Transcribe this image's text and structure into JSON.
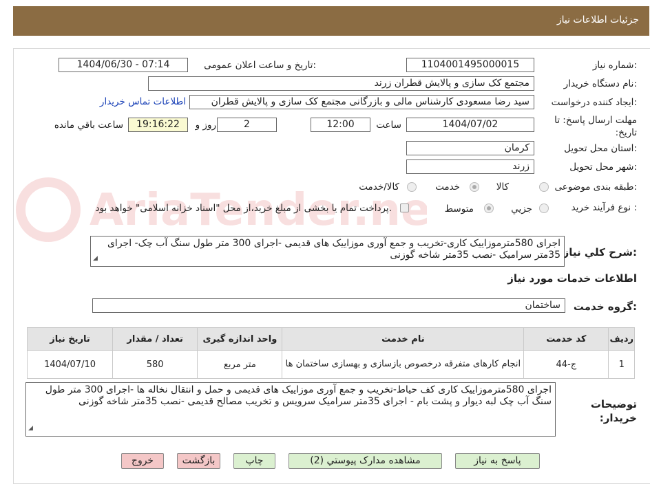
{
  "header": {
    "title": "جزئیات اطلاعات نیاز"
  },
  "form": {
    "need_number_label": "شماره نیاز:",
    "need_number": "1104001495000015",
    "announce_label": "تاریخ و ساعت اعلان عمومی:",
    "announce_value": "1404/06/30 - 07:14",
    "buyer_org_label": "نام دستگاه خریدار:",
    "buyer_org": "مجتمع کک سازی و پالایش قطران زرند",
    "requester_label": "ایجاد کننده درخواست:",
    "requester": "سید رضا مسعودی کارشناس مالی و بازرگانی مجتمع کک سازی و پالایش قطران",
    "contact_link": "اطلاعات تماس خریدار",
    "deadline_label": "مهلت ارسال پاسخ: تا تاریخ:",
    "deadline_date": "1404/07/02",
    "time_label": "ساعت",
    "deadline_time": "12:00",
    "days_value": "2",
    "days_label": "روز و",
    "remaining_time": "19:16:22",
    "remaining_label": "ساعت باقي مانده",
    "province_label": "استان محل تحویل:",
    "province": "کرمان",
    "city_label": "شهر محل تحویل:",
    "city": "زرند",
    "category_label": "طبقه بندی موضوعی:",
    "category_options": [
      "کالا",
      "خدمت",
      "کالا/خدمت"
    ],
    "category_selected": "خدمت",
    "process_label": "نوع فرآیند خرید :",
    "process_options": [
      "جزيي",
      "متوسط"
    ],
    "process_selected": "متوسط",
    "payment_note": "پرداخت تمام یا بخشی از مبلغ خرید،از محل \"اسناد خزانه اسلامی\" خواهد بود.",
    "summary_label": "شرح کلي نياز:",
    "summary_text": "اجرای 580مترموزاییک کاری-تخریب و جمع آوری موزاییک های قدیمی -اجرای 300 متر طول سنگ آب چک- اجرای 35متر سرامیک -نصب 35متر شاخه گوزنی"
  },
  "services": {
    "section_title": "اطلاعات خدمات مورد نياز",
    "group_label": "گروه خدمت:",
    "group_value": "ساختمان",
    "columns": [
      "رديف",
      "کد خدمت",
      "نام خدمت",
      "واحد اندازه گیری",
      "تعداد / مقدار",
      "تاریخ نیاز"
    ],
    "rows": [
      {
        "row": "1",
        "code": "ج-44",
        "name": "انجام کارهای متفرقه درخصوص بازسازی و بهسازی ساختمان ها",
        "unit": "متر مربع",
        "qty": "580",
        "date": "1404/07/10"
      }
    ]
  },
  "buyer_notes": {
    "label": "توضیحات خریدار:",
    "text": "اجرای 580مترموزاییک کاری کف حیاط-تخریب و جمع آوری موزاییک های قدیمی و حمل و انتقال نخاله ها -اجرای 300 متر طول سنگ آب چک لبه دیوار و پشت بام - اجرای 35متر سرامیک سرویس و تخریب مصالح قدیمی -نصب 35متر شاخه گوزنی"
  },
  "buttons": {
    "reply": "پاسخ به نیاز",
    "attachments": "مشاهده مدارک پیوستي (2)",
    "print": "چاپ",
    "back": "بازگشت",
    "exit": "خروج"
  },
  "watermark": {
    "text": "AriaTender.neT"
  },
  "colors": {
    "header": "#8b6c43",
    "link": "#1d44b8",
    "button_green": "#dbf0d0",
    "button_pink": "#f4c7c7",
    "remaining_bg": "#fafad2"
  }
}
